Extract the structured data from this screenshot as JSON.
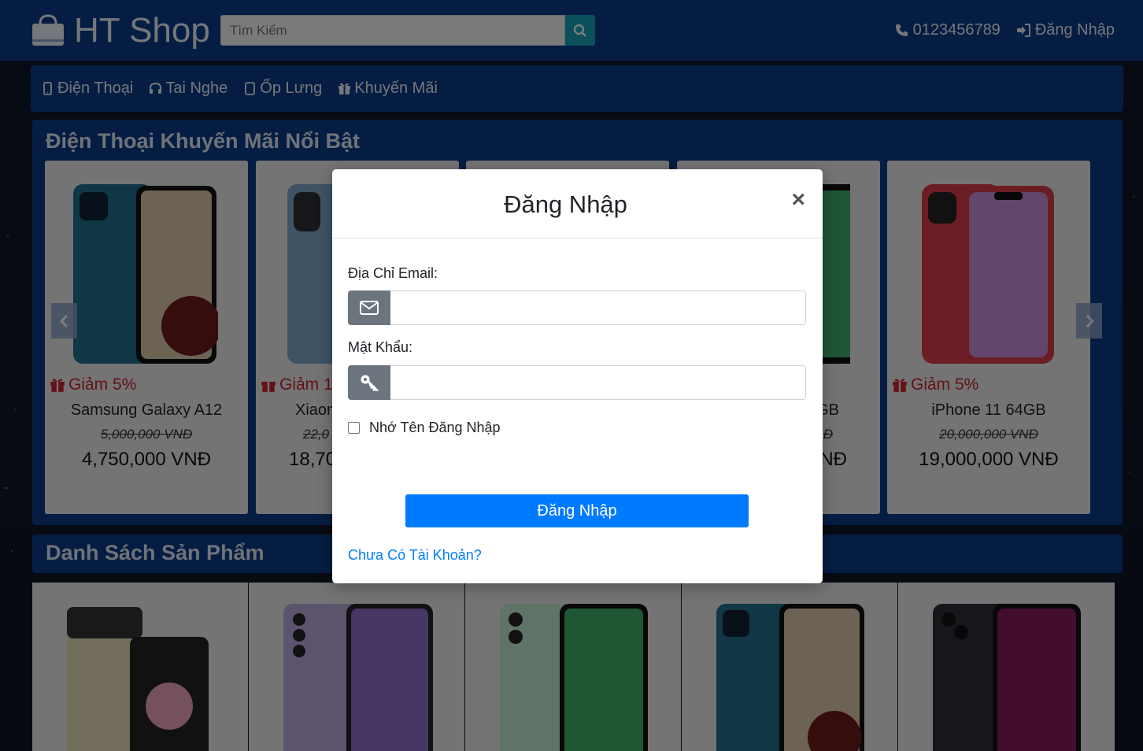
{
  "header": {
    "brand": "HT Shop",
    "search_placeholder": "Tìm Kiếm",
    "phone": "0123456789",
    "login_link": "Đăng Nhập"
  },
  "nav": {
    "items": [
      {
        "label": "Điện Thoại",
        "icon": "mobile-icon"
      },
      {
        "label": "Tai Nghe",
        "icon": "headphones-icon"
      },
      {
        "label": "Ốp Lưng",
        "icon": "case-icon"
      },
      {
        "label": "Khuyến Mãi",
        "icon": "gift-icon"
      }
    ]
  },
  "promo": {
    "title": "Điện Thoại Khuyến Mãi Nổi Bật",
    "cards": [
      {
        "discount": "Giảm 5%",
        "name": "Samsung Galaxy A12",
        "old_price": "5,000,000 VNĐ",
        "new_price": "4,750,000 VNĐ",
        "color": "#1f6f8b"
      },
      {
        "discount": "Giảm 1",
        "name": "Xiaon",
        "old_price": "22,0",
        "new_price": "18,70",
        "color": "#7fa6c8"
      },
      {
        "discount": "",
        "name": "",
        "old_price": "",
        "new_price": "",
        "color": "#3fae8a"
      },
      {
        "discount": "",
        "name": "GB",
        "old_price": "Đ",
        "new_price": "NĐ",
        "color": "#3fae6a"
      },
      {
        "discount": "Giảm 5%",
        "name": "iPhone 11 64GB",
        "old_price": "20,000,000 VNĐ",
        "new_price": "19,000,000 VNĐ",
        "color": "#d63a46"
      }
    ]
  },
  "products": {
    "title": "Danh Sách Sản Phẩm",
    "colors": [
      "#e6dcb8",
      "#b9a9d8",
      "#bfe6cf",
      "#1f6f8b",
      "#2b2f36"
    ]
  },
  "modal": {
    "title": "Đăng Nhập",
    "close": "×",
    "email_label": "Địa Chỉ Email:",
    "password_label": "Mật Khẩu:",
    "remember_label": "Nhớ Tên Đăng Nhập",
    "submit_label": "Đăng Nhập",
    "register_link": "Chưa Có Tài Khoản?"
  }
}
